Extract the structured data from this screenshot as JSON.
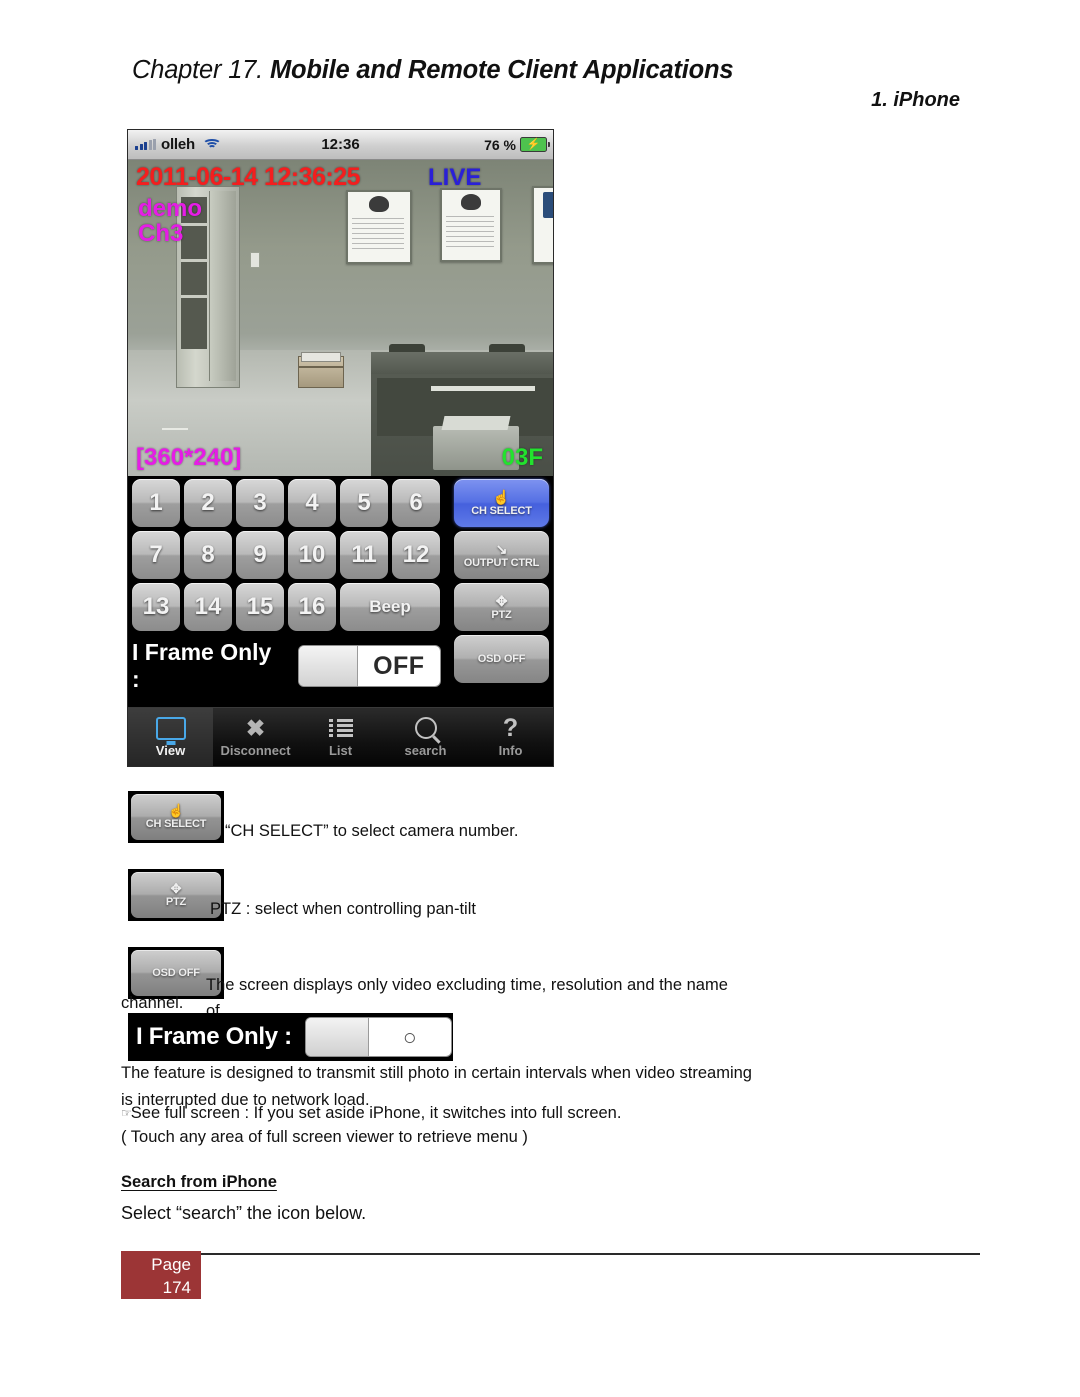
{
  "header": {
    "chapter": "Chapter 17.",
    "title": "Mobile and Remote Client Applications",
    "section": "1. iPhone"
  },
  "phone": {
    "statusbar": {
      "carrier": "olleh",
      "time": "12:36",
      "battery_percent": "76 %"
    },
    "video_osd": {
      "timestamp": "2011-06-14 12:36:25",
      "mode": "LIVE",
      "site": "demo",
      "channel": "Ch3",
      "resolution": "[360*240]",
      "location": "03F",
      "colors": {
        "timestamp": "#f41e1e",
        "mode": "#2a20d8",
        "site": "#e61ce6",
        "resolution": "#e61ce6",
        "location": "#22e22e"
      }
    },
    "keypad": {
      "row1": [
        "1",
        "2",
        "3",
        "4",
        "5",
        "6"
      ],
      "row2": [
        "7",
        "8",
        "9",
        "10",
        "11",
        "12"
      ],
      "row3": [
        "13",
        "14",
        "15",
        "16"
      ],
      "beep_label": "Beep",
      "iframe_label": "I Frame Only :",
      "iframe_value": "OFF"
    },
    "side_buttons": [
      {
        "label": "CH SELECT",
        "icon": "hand-pointer-icon",
        "active": true
      },
      {
        "label": "OUTPUT CTRL",
        "icon": "switch-lever-icon",
        "active": false
      },
      {
        "label": "PTZ",
        "icon": "pan-tilt-zoom-icon",
        "active": false
      },
      {
        "label": "OSD OFF",
        "icon": "",
        "active": false
      }
    ],
    "tabbar": [
      {
        "label": "View",
        "icon": "monitor-icon",
        "selected": true
      },
      {
        "label": "Disconnect",
        "icon": "close-x-icon",
        "selected": false
      },
      {
        "label": "List",
        "icon": "list-icon",
        "selected": false
      },
      {
        "label": "search",
        "icon": "search-icon",
        "selected": false
      },
      {
        "label": "Info",
        "icon": "question-mark-icon",
        "selected": false
      }
    ]
  },
  "legend": {
    "ch_select_chip": "CH SELECT",
    "ch_select_text": "“CH SELECT” to select camera number.",
    "ptz_chip": "PTZ",
    "ptz_text": "PTZ : select when controlling pan-tilt",
    "osd_chip": "OSD OFF",
    "osd_text": "The screen displays only video excluding time, resolution and the name of",
    "osd_text_cont": "channel."
  },
  "iframe_widget": {
    "label": "I Frame Only :",
    "value": "○"
  },
  "paragraphs": {
    "p1_line1": "The feature is designed to transmit still photo in certain intervals when video streaming",
    "p1_line2": "is interrupted due to network load.",
    "p2": "See full screen : If you set aside iPhone, it switches into full screen.",
    "p2_bullet": "☞",
    "p3": "( Touch any area of full screen viewer to retrieve menu )"
  },
  "search_section": {
    "heading": "Search from iPhone",
    "line": "Select “search” the icon below."
  },
  "footer": {
    "page_label": "Page",
    "page_number": "174",
    "accent_color": "#9c3536"
  }
}
